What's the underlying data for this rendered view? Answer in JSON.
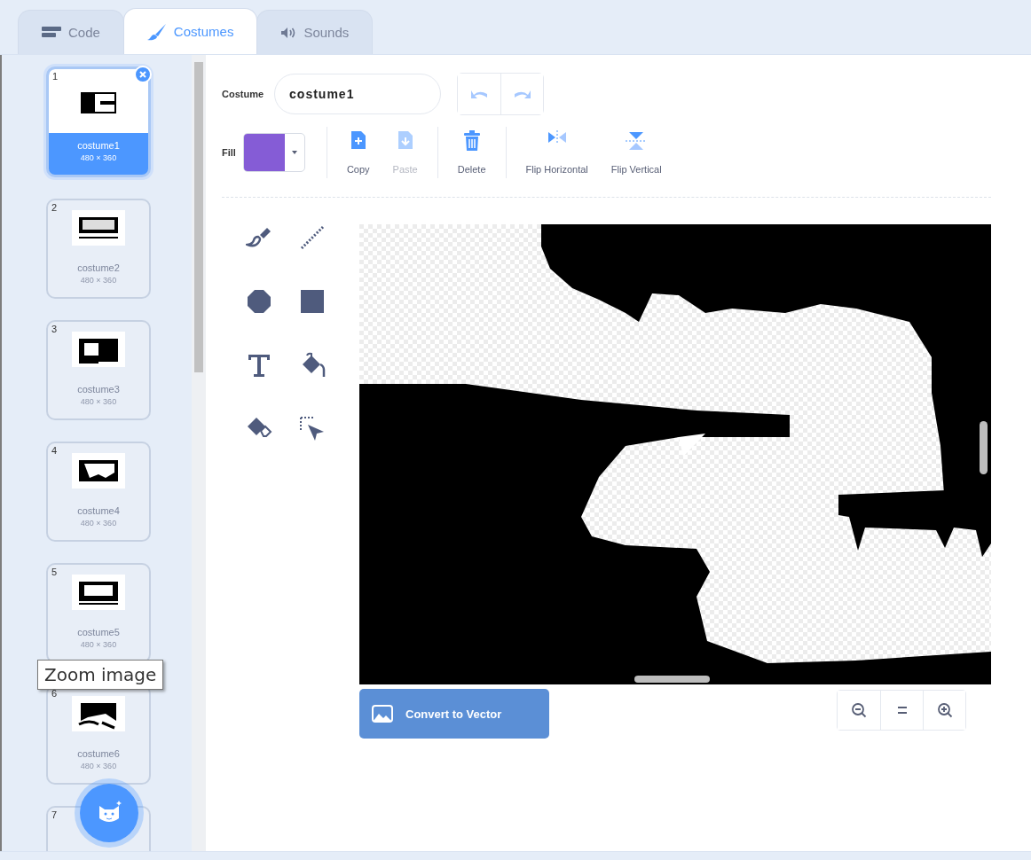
{
  "tabs": [
    {
      "kind": "code",
      "label": "Code",
      "selected": false
    },
    {
      "kind": "costumes",
      "label": "Costumes",
      "selected": true
    },
    {
      "kind": "sounds",
      "label": "Sounds",
      "selected": false
    }
  ],
  "costumes": [
    {
      "number": "1",
      "name": "costume1",
      "size": "480 × 360",
      "selected": true
    },
    {
      "number": "2",
      "name": "costume2",
      "size": "480 × 360",
      "selected": false
    },
    {
      "number": "3",
      "name": "costume3",
      "size": "480 × 360",
      "selected": false
    },
    {
      "number": "4",
      "name": "costume4",
      "size": "480 × 360",
      "selected": false
    },
    {
      "number": "5",
      "name": "costume5",
      "size": "480 × 360",
      "selected": false
    },
    {
      "number": "6",
      "name": "costume6",
      "size": "480 × 360",
      "selected": false
    },
    {
      "number": "7",
      "selected": false
    }
  ],
  "tooltip": "Zoom image",
  "editor": {
    "costume_label": "Costume",
    "costume_name": "costume1",
    "history": [
      {
        "kind": "undo",
        "disabled": true
      },
      {
        "kind": "redo",
        "disabled": true
      }
    ],
    "fill": {
      "label": "Fill",
      "color": "#855cd6"
    },
    "actions": [
      {
        "kind": "copy",
        "label": "Copy",
        "disabled": false
      },
      {
        "kind": "paste",
        "label": "Paste",
        "disabled": true
      },
      {
        "kind": "delete",
        "label": "Delete",
        "disabled": false
      },
      {
        "kind": "flip-horizontal",
        "label": "Flip Horizontal",
        "disabled": false
      },
      {
        "kind": "flip-vertical",
        "label": "Flip Vertical",
        "disabled": false
      }
    ],
    "tools": [
      {
        "kind": "brush"
      },
      {
        "kind": "line"
      },
      {
        "kind": "circle"
      },
      {
        "kind": "rectangle"
      },
      {
        "kind": "text"
      },
      {
        "kind": "fill"
      },
      {
        "kind": "eraser"
      },
      {
        "kind": "select"
      }
    ],
    "convert_button": "Convert to Vector",
    "zoom_controls": [
      {
        "kind": "zoom-out"
      },
      {
        "kind": "reset"
      },
      {
        "kind": "zoom-in"
      }
    ]
  }
}
